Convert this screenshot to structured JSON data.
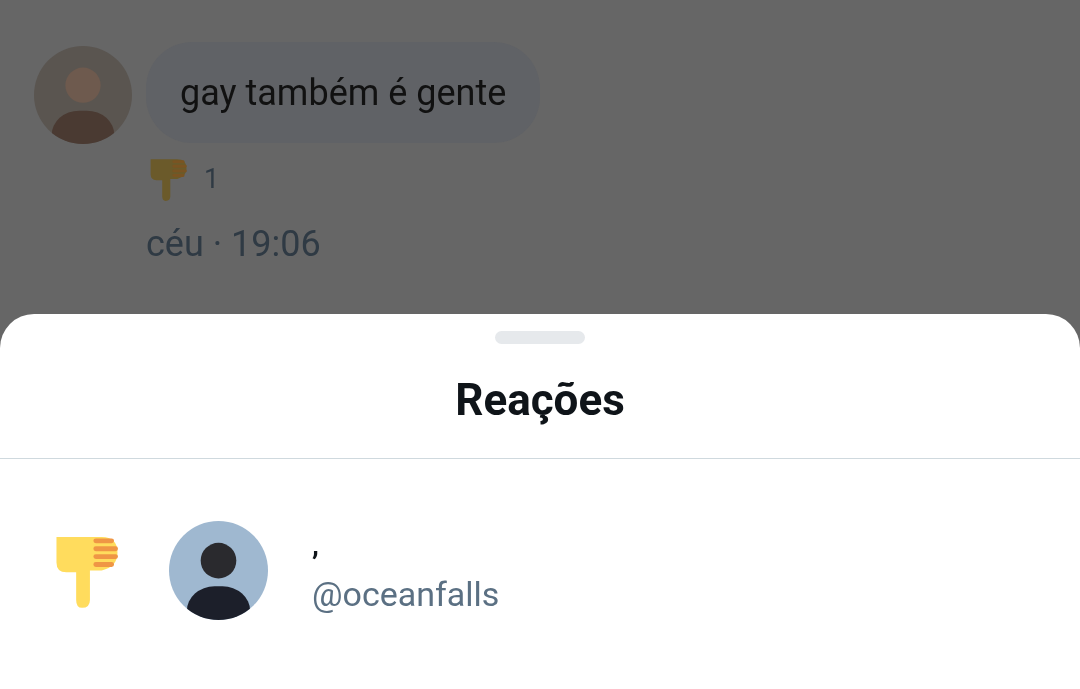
{
  "message": {
    "text": "gay também é gente",
    "reaction_count": "1",
    "meta": "céu · 19:06"
  },
  "sheet": {
    "title": "Reações",
    "reactions": [
      {
        "display_name": ",",
        "handle": "@oceanfalls"
      }
    ]
  }
}
